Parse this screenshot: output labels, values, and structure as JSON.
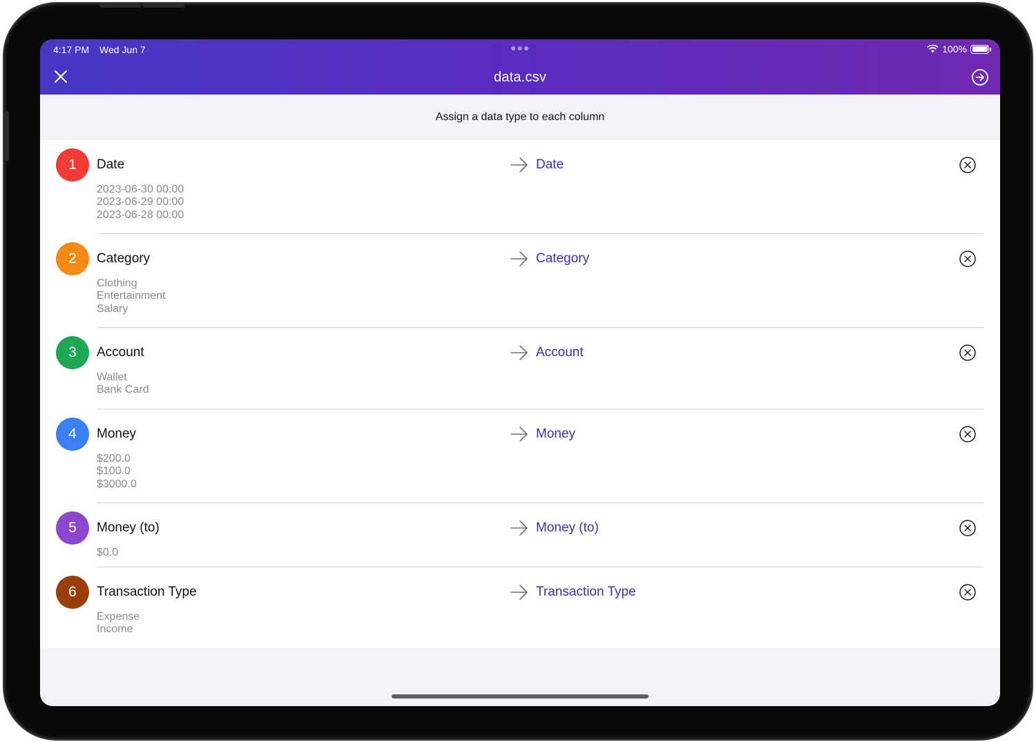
{
  "status_bar": {
    "time": "4:17 PM",
    "date": "Wed Jun 7",
    "battery": "100%"
  },
  "header": {
    "title": "data.csv"
  },
  "subheader": {
    "text": "Assign a data type to each column"
  },
  "icons": {
    "close": "close-icon",
    "next": "arrow-circle-right-icon",
    "mapping": "arrow-right-icon",
    "remove": "close-circle-icon"
  },
  "columns": [
    {
      "number": "1",
      "name": "Date",
      "color": "#f23b35",
      "samples": [
        "2023-06-30 00:00",
        "2023-06-29 00:00",
        "2023-06-28 00:00"
      ],
      "type": "Date"
    },
    {
      "number": "2",
      "name": "Category",
      "color": "#f48a14",
      "samples": [
        "Clothing",
        "Entertainment",
        "Salary"
      ],
      "type": "Category"
    },
    {
      "number": "3",
      "name": "Account",
      "color": "#1ea853",
      "samples": [
        "Wallet",
        "Bank Card"
      ],
      "type": "Account"
    },
    {
      "number": "4",
      "name": "Money",
      "color": "#3b7ff5",
      "samples": [
        "$200.0",
        "$100.0",
        "$3000.0"
      ],
      "type": "Money"
    },
    {
      "number": "5",
      "name": "Money (to)",
      "color": "#8a46cc",
      "samples": [
        "$0.0"
      ],
      "type": "Money (to)"
    },
    {
      "number": "6",
      "name": "Transaction Type",
      "color": "#9a3f0c",
      "samples": [
        "Expense",
        "Income"
      ],
      "type": "Transaction Type"
    }
  ]
}
